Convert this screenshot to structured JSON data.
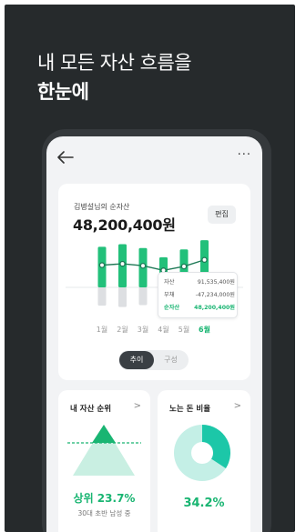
{
  "promo": {
    "line1": "내 모든 자산 흐름을",
    "line2": "한눈에"
  },
  "app": {
    "back_icon": "arrow-left-icon",
    "more_label": "···"
  },
  "summary": {
    "owner_label": "김병설님의 순자산",
    "net_worth": "48,200,400원",
    "edit_label": "편집"
  },
  "chart_data": {
    "type": "bar",
    "categories": [
      "1월",
      "2월",
      "3월",
      "4월",
      "5월",
      "6월"
    ],
    "selected_category": "6월",
    "series": [
      {
        "name": "자산",
        "values": [
          62,
          66,
          60,
          46,
          58,
          72
        ]
      },
      {
        "name": "부채",
        "values": [
          -28,
          -30,
          -27,
          -20,
          -26,
          -30
        ]
      },
      {
        "name": "순자산",
        "values": [
          34,
          36,
          33,
          26,
          32,
          42
        ]
      }
    ],
    "colors": {
      "asset": "#22c07a",
      "debt": "#dddfe2",
      "net_line": "#1f7a57"
    },
    "ylim": [
      -40,
      80
    ]
  },
  "tooltip": {
    "rows": [
      {
        "label": "자산",
        "value": "91,535,400원"
      },
      {
        "label": "부채",
        "value": "-47,234,000원"
      },
      {
        "label": "순자산",
        "value": "48,200,400원"
      }
    ]
  },
  "toggle": {
    "active": "추이",
    "inactive": "구성"
  },
  "rank_card": {
    "title": "내 자산 순위",
    "chevron": ">",
    "value": "상위 23.7%",
    "percentile": 23.7,
    "subtitle": "30대 초반 남성 중"
  },
  "idle_card": {
    "title": "노는 돈 비율",
    "chevron": ">",
    "value": "34.2%",
    "ratio": 0.342
  },
  "colors": {
    "accent": "#19b572",
    "background": "#262a2c",
    "card": "#ffffff"
  }
}
